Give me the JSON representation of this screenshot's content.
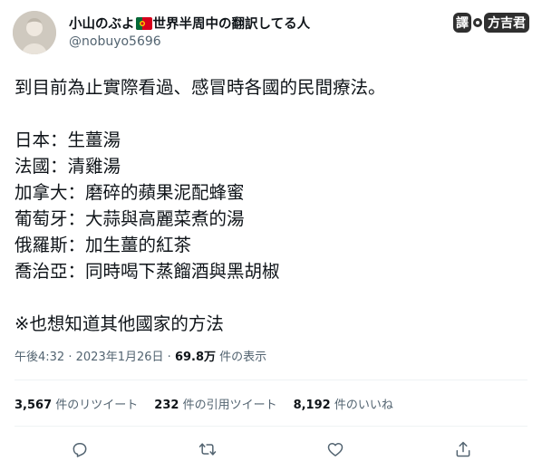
{
  "author": {
    "name_prefix": "小山のぶよ",
    "name_suffix": "世界半周中の翻訳してる人",
    "handle": "@nobuyo5696"
  },
  "translator": {
    "label_1": "譯",
    "label_2": "方吉君"
  },
  "tweet": {
    "lines": [
      "到目前為止實際看過、感冒時各國的民間療法。",
      "",
      "日本：生薑湯",
      "法國：清雞湯",
      "加拿大：磨碎的蘋果泥配蜂蜜",
      "葡萄牙：大蒜與高麗菜煮的湯",
      "俄羅斯：加生薑的紅茶",
      "喬治亞：同時喝下蒸餾酒與黑胡椒",
      "",
      "※也想知道其他國家的方法"
    ]
  },
  "meta": {
    "time": "午後4:32",
    "sep1": "·",
    "date": "2023年1月26日",
    "sep2": "·",
    "views_count": "69.8万",
    "views_label": "件の表示"
  },
  "stats": {
    "retweets_count": "3,567",
    "retweets_label": "件のリツイート",
    "quotes_count": "232",
    "quotes_label": "件の引用ツイート",
    "likes_count": "8,192",
    "likes_label": "件のいいね"
  },
  "icons": {
    "reply": "reply-icon",
    "retweet": "retweet-icon",
    "like": "heart-icon",
    "share": "share-icon"
  },
  "colors": {
    "text": "#0f1419",
    "secondary": "#536471",
    "divider": "#eff3f4"
  }
}
